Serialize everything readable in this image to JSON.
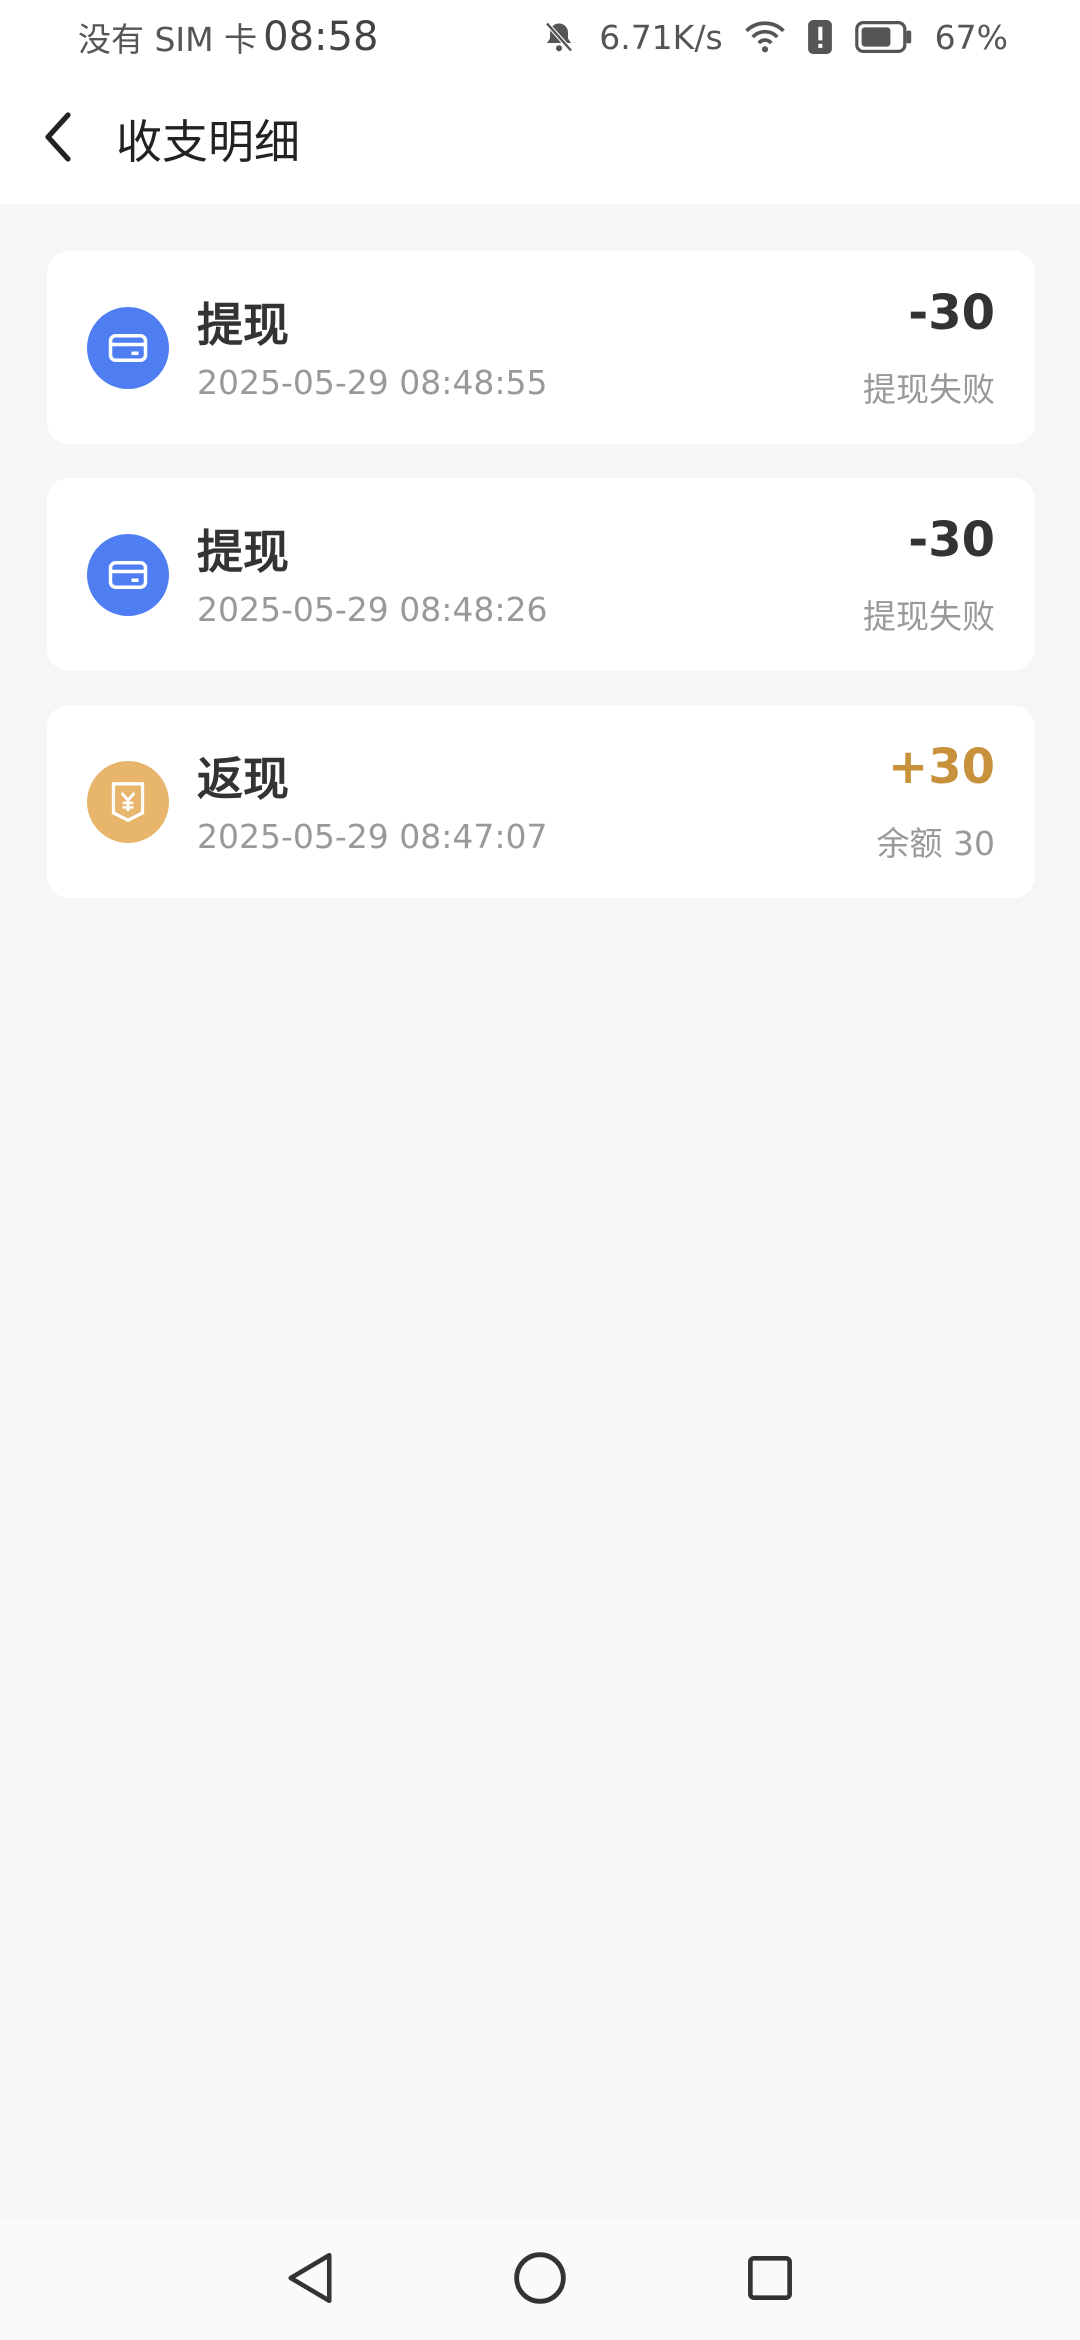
{
  "status_bar": {
    "carrier": "没有 SIM 卡",
    "time": "08:58",
    "speed": "6.71K/s",
    "battery": "67%"
  },
  "header": {
    "title": "收支明细"
  },
  "transactions": [
    {
      "title": "提现",
      "datetime": "2025-05-29 08:48:55",
      "amount": "-30",
      "sub": "提现失败",
      "icon": "card-icon",
      "color": "#4f7ef3"
    },
    {
      "title": "提现",
      "datetime": "2025-05-29 08:48:26",
      "amount": "-30",
      "sub": "提现失败",
      "icon": "card-icon",
      "color": "#4f7ef3"
    },
    {
      "title": "返现",
      "datetime": "2025-05-29 08:47:07",
      "amount": "+30",
      "sub": "余额 30",
      "icon": "yuan-envelope-icon",
      "color": "#e7b56c"
    }
  ],
  "accent_colors": {
    "positive_amount": "#c8923c",
    "withdraw_icon": "#4f7ef3",
    "cashback_icon": "#e7b56c"
  }
}
